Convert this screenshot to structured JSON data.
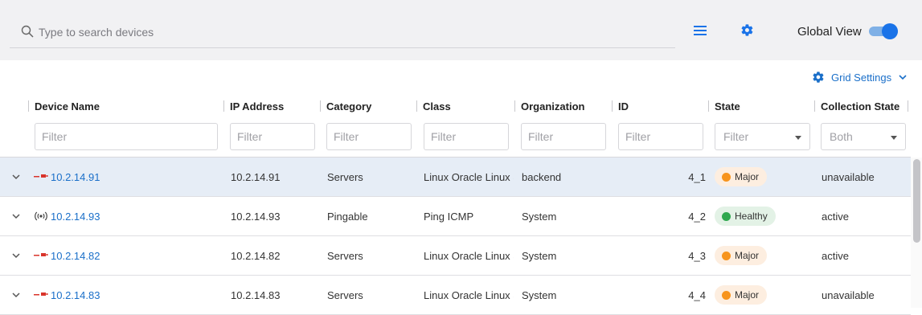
{
  "search": {
    "placeholder": "Type to search devices"
  },
  "toolbar": {
    "global_view_label": "Global View",
    "global_view_on": true
  },
  "grid_settings": {
    "label": "Grid Settings"
  },
  "columns": [
    {
      "label": "Device Name"
    },
    {
      "label": "IP Address"
    },
    {
      "label": "Category"
    },
    {
      "label": "Class"
    },
    {
      "label": "Organization"
    },
    {
      "label": "ID"
    },
    {
      "label": "State"
    },
    {
      "label": "Collection State"
    }
  ],
  "filters": {
    "placeholder": "Filter",
    "state_select": "Filter",
    "collection_select": "Both"
  },
  "colors": {
    "accent": "#1a6fc9",
    "major": "#f7941d",
    "healthy": "#2fa84f",
    "selected_row": "#e6edf6"
  },
  "rows": [
    {
      "icon": "server-icon",
      "name": "10.2.14.91",
      "ip": "10.2.14.91",
      "category": "Servers",
      "class": "Linux Oracle Linux Server",
      "org": "backend",
      "id": "4_1",
      "state": "Major",
      "collection": "unavailable",
      "selected": true
    },
    {
      "icon": "ping-icon",
      "name": "10.2.14.93",
      "ip": "10.2.14.93",
      "category": "Pingable",
      "class": "Ping ICMP",
      "org": "System",
      "id": "4_2",
      "state": "Healthy",
      "collection": "active",
      "selected": false
    },
    {
      "icon": "server-icon",
      "name": "10.2.14.82",
      "ip": "10.2.14.82",
      "category": "Servers",
      "class": "Linux Oracle Linux Server",
      "org": "System",
      "id": "4_3",
      "state": "Major",
      "collection": "active",
      "selected": false
    },
    {
      "icon": "server-icon",
      "name": "10.2.14.83",
      "ip": "10.2.14.83",
      "category": "Servers",
      "class": "Linux Oracle Linux Server",
      "org": "System",
      "id": "4_4",
      "state": "Major",
      "collection": "unavailable",
      "selected": false
    }
  ]
}
